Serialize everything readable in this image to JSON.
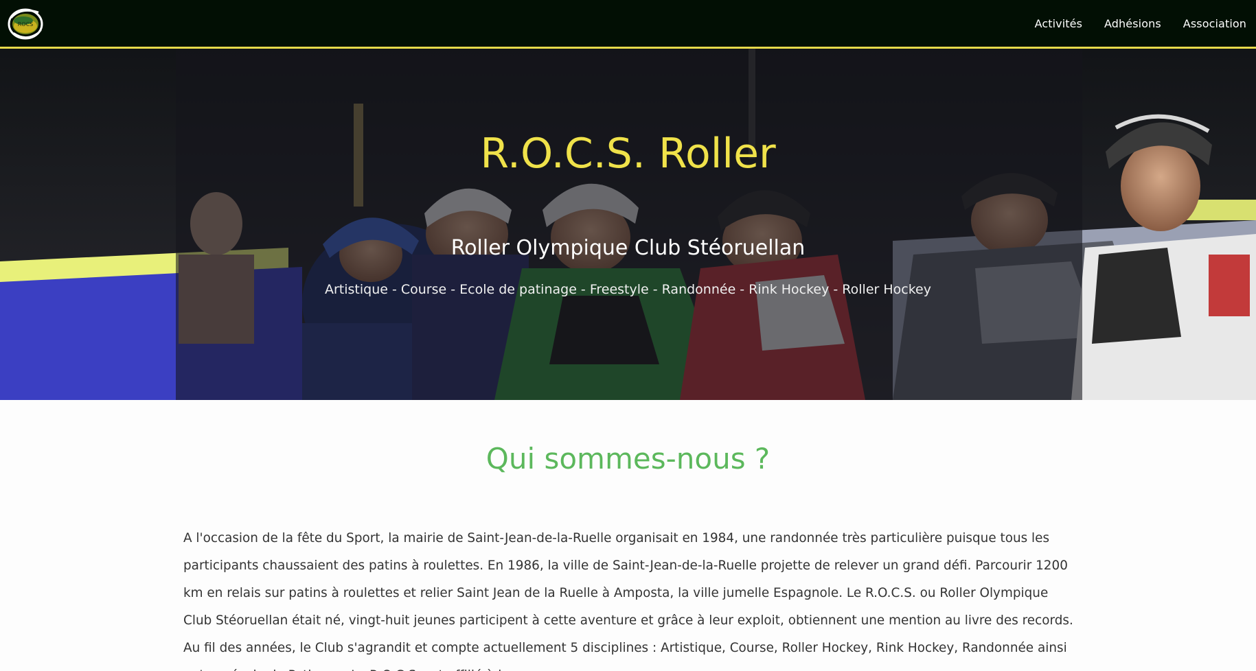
{
  "navbar": {
    "logo_alt": "R.O.C.S. logo",
    "links": [
      {
        "label": "Activités"
      },
      {
        "label": "Adhésions"
      },
      {
        "label": "Association"
      }
    ]
  },
  "hero": {
    "title": "R.O.C.S. Roller",
    "subtitle": "Roller Olympique Club Stéoruellan",
    "disciplines": "Artistique - Course - Ecole de patinage - Freestyle - Randonnée - Rink Hockey - Roller Hockey"
  },
  "about": {
    "title": "Qui sommes-nous ?",
    "text": "A l'occasion de la fête du Sport, la mairie de Saint-Jean-de-la-Ruelle organisait en 1984, une randonnée très particulière puisque tous les participants chaussaient des patins à roulettes. En 1986, la ville de Saint-Jean-de-la-Ruelle projette de relever un grand défi. Parcourir 1200 km en relais sur patins à roulettes et relier Saint Jean de la Ruelle à Amposta, la ville jumelle Espagnole. Le R.O.C.S. ou Roller Olympique Club Stéoruellan était né, vingt-huit jeunes participent à cette aventure et grâce à leur exploit, obtiennent une mention au livre des records. Au fil des années, le Club s'agrandit et compte actuellement 5 disciplines : Artistique, Course, Roller Hockey, Rink Hockey, Randonnée ainsi qu'une école de Patinage. Le R.O.C.S. est affilié à la"
  },
  "colors": {
    "navbar_bg": "#020f04",
    "navbar_border": "#e6d94a",
    "hero_title": "#f0e24a",
    "section_title": "#5cb85c",
    "body_text": "#333333"
  }
}
